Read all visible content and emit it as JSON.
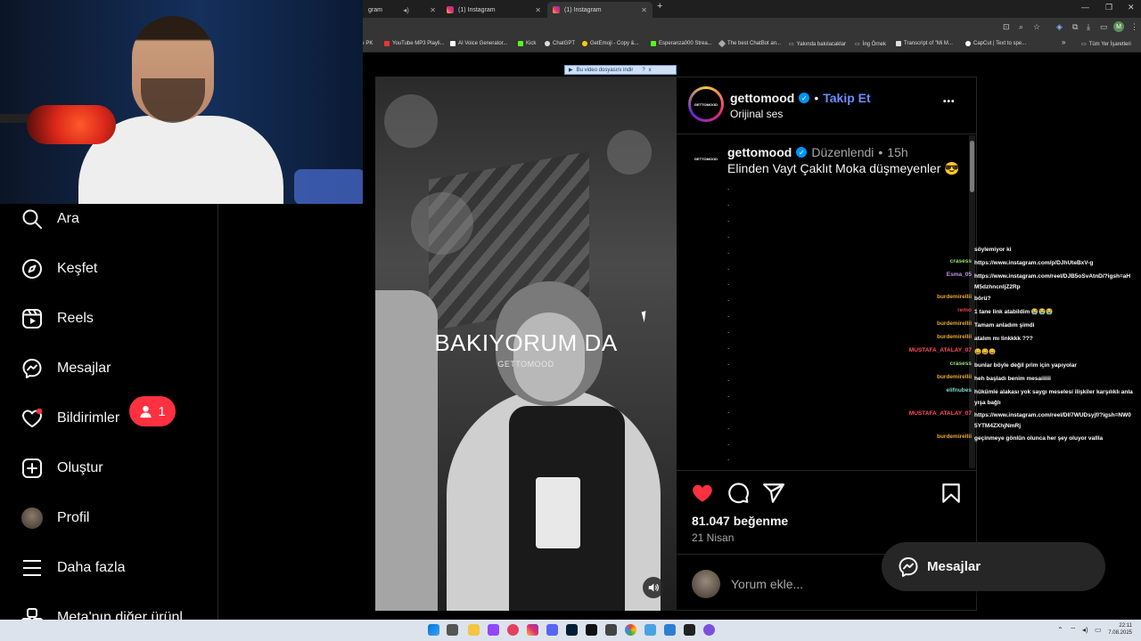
{
  "browser": {
    "tabs": [
      {
        "label": "gram"
      },
      {
        "label": "(1) Instagram"
      },
      {
        "label": "(1) Instagram"
      }
    ],
    "new_tab": "+",
    "bookmarks": [
      "ı PK",
      "YouTube MP3 Playli...",
      "AI Voice Generator...",
      "Kick",
      "ChatGPT",
      "GetEmoji - Copy &...",
      "Esperanza000 Strea...",
      "The best ChatBot an...",
      "Yakında bakılacaklar",
      "İng Örnek",
      "Transcript of \"Mi M...",
      "CapCut | Text to spe..."
    ],
    "bookmarks_more": "»",
    "all_bookmarks": "Tüm Yer İşaretleri",
    "profile_initial": "M",
    "download_bar": "Bu video dosyasını indir",
    "download_help": "?",
    "download_close": "x"
  },
  "sidebar": {
    "items": [
      {
        "label": "Ara",
        "icon": "search-icon"
      },
      {
        "label": "Keşfet",
        "icon": "compass-icon"
      },
      {
        "label": "Reels",
        "icon": "reels-icon"
      },
      {
        "label": "Mesajlar",
        "icon": "messenger-icon"
      },
      {
        "label": "Bildirimler",
        "icon": "heart-icon"
      },
      {
        "label": "Oluştur",
        "icon": "plus-square-icon"
      },
      {
        "label": "Profil",
        "icon": "avatar"
      },
      {
        "label": "Daha fazla",
        "icon": "menu-icon"
      },
      {
        "label": "Meta'nın diğer ürünl",
        "icon": "meta-apps-icon"
      }
    ],
    "notif_count": "1"
  },
  "video": {
    "title": "BAKIYORUM DA",
    "subtitle": "GETTOMOOD"
  },
  "post": {
    "username": "gettomood",
    "separator": "•",
    "follow": "Takip Et",
    "audio": "Orijinal ses",
    "more": "•••",
    "logo_text": "GETTOMOOD",
    "caption_user": "gettomood",
    "edited": "Düzenlendi",
    "time": "15h",
    "caption": "Elinden Vayt Çaklıt Moka düşmeyenler 😎",
    "dots": [
      ".",
      ".",
      ".",
      ".",
      ".",
      ".",
      ".",
      ".",
      ".",
      ".",
      ".",
      ".",
      ".",
      ".",
      ".",
      ".",
      ".",
      "."
    ],
    "likes": "81.047 beğenme",
    "date": "21 Nisan",
    "comment_placeholder": "Yorum ekle..."
  },
  "chat": [
    {
      "user": "",
      "msg": "söylemiyor ki",
      "color": "#ffffff"
    },
    {
      "user": "crasess",
      "msg": "https://www.instagram.com/p/DJhUteBxV-g",
      "color": "#9adf6a"
    },
    {
      "user": "Esma_05",
      "msg": "https://www.instagram.com/reel/DJB5oSvAtnD/?igsh=aHM5dzhncnljZ2Rp",
      "color": "#c792ea"
    },
    {
      "user": "burdemirellii",
      "msg": "börü?",
      "color": "#f0a830"
    },
    {
      "user": "remo",
      "msg": "1 tane link atabildim 😭😭😭",
      "color": "#e0404a"
    },
    {
      "user": "burdemirellii",
      "msg": "Tamam anladım şimdi",
      "color": "#f0a830"
    },
    {
      "user": "burdemirellii",
      "msg": "atalım mı linkkkk ???",
      "color": "#f0a830"
    },
    {
      "user": "MUSTAFA_ATALAY_07",
      "msg": "😀😀😀",
      "color": "#ff4d5e"
    },
    {
      "user": "crasess",
      "msg": "bunlar böyle değil prim için yapıyolar",
      "color": "#9adf6a"
    },
    {
      "user": "burdemirellii",
      "msg": "heh başladı benim mesaiiiiii",
      "color": "#f0a830"
    },
    {
      "user": "elifnubes",
      "msg": "hükümle alakası yok saygı meselesi ilişkiler karşılıklı anlayışa bağlı",
      "color": "#7fd8d0"
    },
    {
      "user": "MUSTAFA_ATALAY_07",
      "msg": "https://www.instagram.com/reel/DIl7WUDsyjf/?igsh=NW05YTM4ZXhjNmRj",
      "color": "#ff4d5e"
    },
    {
      "user": "burdemirellii",
      "msg": "geçinmeye gönlün olunca her şey oluyor vallla",
      "color": "#f0a830"
    }
  ],
  "messages_button": "Mesajlar",
  "taskbar": {
    "time": "22:11",
    "date": "7.08.2025"
  }
}
